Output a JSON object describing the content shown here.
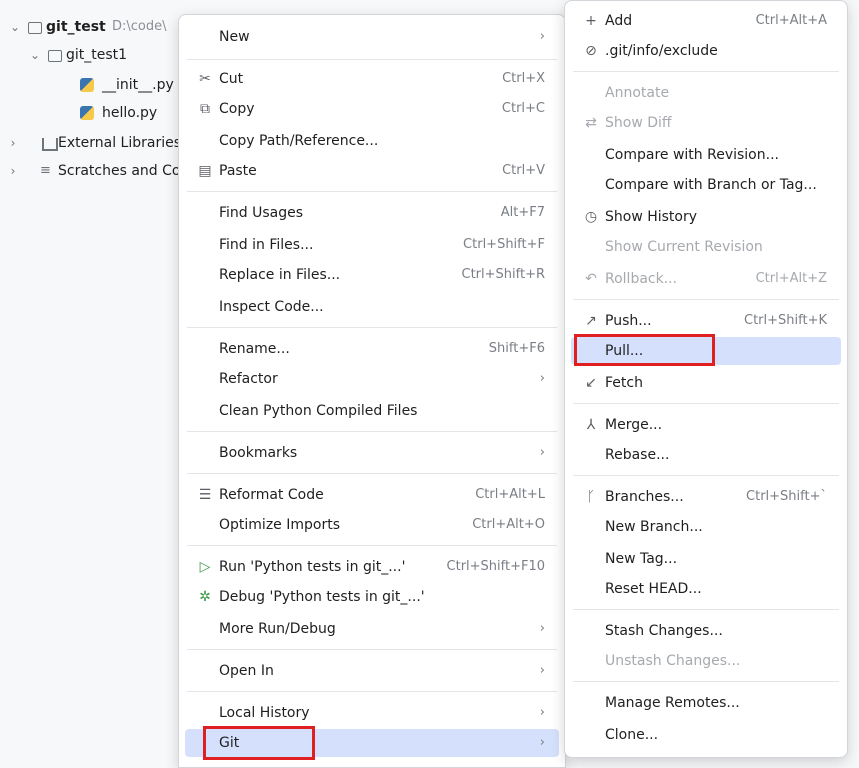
{
  "project_tree": {
    "root_name": "git_test",
    "root_path": "D:\\code\\",
    "folder": "git_test1",
    "files": [
      "__init__.py",
      "hello.py"
    ],
    "external_libraries": "External Libraries",
    "scratches": "Scratches and Co"
  },
  "context_menu": {
    "new": "New",
    "cut": "Cut",
    "cut_sc": "Ctrl+X",
    "copy": "Copy",
    "copy_sc": "Ctrl+C",
    "copy_path": "Copy Path/Reference...",
    "paste": "Paste",
    "paste_sc": "Ctrl+V",
    "find_usages": "Find Usages",
    "find_usages_sc": "Alt+F7",
    "find_in_files": "Find in Files...",
    "find_in_files_sc": "Ctrl+Shift+F",
    "replace_in_files": "Replace in Files...",
    "replace_in_files_sc": "Ctrl+Shift+R",
    "inspect_code": "Inspect Code...",
    "rename": "Rename...",
    "rename_sc": "Shift+F6",
    "refactor": "Refactor",
    "clean_python": "Clean Python Compiled Files",
    "bookmarks": "Bookmarks",
    "reformat_code": "Reformat Code",
    "reformat_code_sc": "Ctrl+Alt+L",
    "optimize_imports": "Optimize Imports",
    "optimize_imports_sc": "Ctrl+Alt+O",
    "run": "Run 'Python tests in git_...'",
    "run_sc": "Ctrl+Shift+F10",
    "debug": "Debug 'Python tests in git_...'",
    "more_run_debug": "More Run/Debug",
    "open_in": "Open In",
    "local_history": "Local History",
    "git": "Git"
  },
  "git_menu": {
    "add": "Add",
    "add_sc": "Ctrl+Alt+A",
    "exclude": ".git/info/exclude",
    "annotate": "Annotate",
    "show_diff": "Show Diff",
    "compare_revision": "Compare with Revision...",
    "compare_branch": "Compare with Branch or Tag...",
    "show_history": "Show History",
    "show_current_revision": "Show Current Revision",
    "rollback": "Rollback...",
    "rollback_sc": "Ctrl+Alt+Z",
    "push": "Push...",
    "push_sc": "Ctrl+Shift+K",
    "pull": "Pull...",
    "fetch": "Fetch",
    "merge": "Merge...",
    "rebase": "Rebase...",
    "branches": "Branches...",
    "branches_sc": "Ctrl+Shift+`",
    "new_branch": "New Branch...",
    "new_tag": "New Tag...",
    "reset_head": "Reset HEAD...",
    "stash": "Stash Changes...",
    "unstash": "Unstash Changes...",
    "manage_remotes": "Manage Remotes...",
    "clone": "Clone..."
  },
  "colors": {
    "selection": "#d5e1fc",
    "highlight_box": "#e02020"
  }
}
